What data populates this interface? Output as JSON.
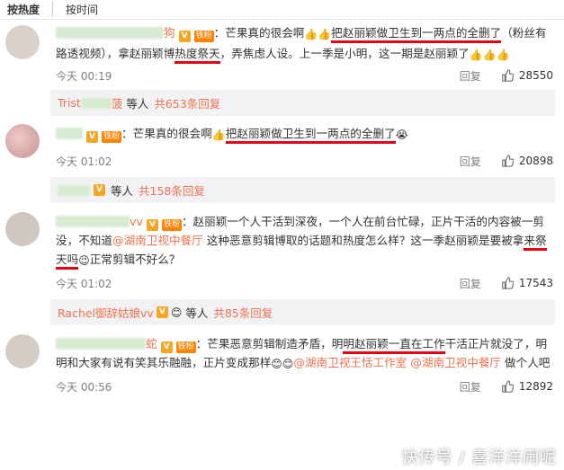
{
  "sort": {
    "hot": "按热度",
    "time": "按时间"
  },
  "comments": [
    {
      "name_tail": "狗",
      "segments": [
        "：芒果真的很会啊",
        "把赵丽颖做卫生到一两点的全删了",
        "（粉丝有路透视频），拿赵丽颖博",
        "热度祭天",
        "，弄焦虑人设。上一季是小明，这一期是赵丽颖了"
      ],
      "time": "今天 00:19",
      "reply": "回复",
      "likes": "28550",
      "sub": {
        "who": "Trist",
        "who_tail": "菠",
        "mid": "等人",
        "count": "共653条回复"
      }
    },
    {
      "name_tail": "",
      "segments": [
        "：芒果真的很会啊",
        "把赵丽颖做卫生到一两点的全删了"
      ],
      "time": "今天 01:02",
      "reply": "回复",
      "likes": "20898",
      "sub": {
        "who": "",
        "who_tail": "",
        "mid": "等人",
        "count": "共158条回复"
      }
    },
    {
      "name_tail": "vv",
      "segments": [
        "：赵丽颖一个人干活到深夜，一个人在前台忙碌，正片干活的内容被一剪没，不知道",
        "@湖南卫视中餐厅",
        " 这种恶意剪辑博取的话题和热度怎么样？这一季赵丽颖是要被拿",
        "来祭天吗",
        "正常剪辑不好么？"
      ],
      "time": "今天 01:02",
      "reply": "回复",
      "likes": "17543",
      "sub": {
        "who": "Rachel御辞姑娘vv",
        "who_tail": "",
        "mid": "等人",
        "count": "共85条回复"
      }
    },
    {
      "name_tail": "蛇",
      "segments": [
        "：芒果恶意剪辑制造矛盾，明",
        "明赵丽颖一直在工作",
        "干活正片就没了，明明和大家有说有笑其乐融融，正片变成那样",
        "@湖南卫视王恬工作室",
        " ",
        "@湖南卫视中餐厅",
        " 做个人吧"
      ],
      "time": "今天 00:56",
      "reply": "回复",
      "likes": "12892"
    }
  ],
  "badges": {
    "v": "V",
    "fan": "铁粉"
  },
  "emojis": {
    "thumb": "👍",
    "cry": "😭",
    "smile": "😊",
    "wink": "😉"
  },
  "watermark": "快传号 / 喜洋洋闹呢",
  "colors": {
    "accent": "#eb7350",
    "underline": "#e60012",
    "subbg": "#f2f2f5"
  }
}
